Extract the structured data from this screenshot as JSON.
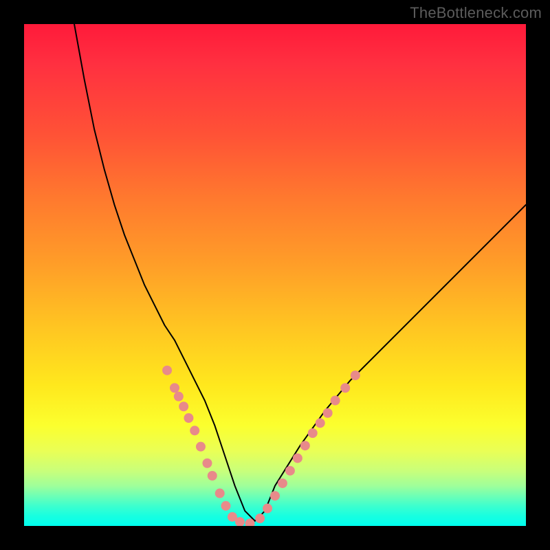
{
  "watermark": "TheBottleneck.com",
  "chart_data": {
    "type": "line",
    "title": "",
    "xlabel": "",
    "ylabel": "",
    "xlim": [
      0,
      100
    ],
    "ylim": [
      0,
      100
    ],
    "grid": false,
    "series": [
      {
        "name": "curve",
        "color": "#000000",
        "stroke_width": 2,
        "x": [
          10,
          12,
          14,
          16,
          18,
          20,
          22,
          24,
          26,
          28,
          30,
          32,
          34,
          36,
          38,
          40,
          42,
          44,
          46,
          48,
          50,
          55,
          60,
          65,
          70,
          75,
          80,
          85,
          90,
          95,
          100
        ],
        "y": [
          100,
          89,
          79,
          71,
          64,
          58,
          53,
          48,
          44,
          40,
          37,
          33,
          29,
          25,
          20,
          14,
          8,
          3,
          1,
          3,
          8,
          16,
          23,
          29,
          34,
          39,
          44,
          49,
          54,
          59,
          64
        ]
      }
    ],
    "markers": {
      "name": "dots",
      "color": "#e88a8a",
      "radius_px": 7,
      "points": [
        {
          "x": 28.5,
          "y": 31.0
        },
        {
          "x": 30.0,
          "y": 27.5
        },
        {
          "x": 30.8,
          "y": 25.8
        },
        {
          "x": 31.8,
          "y": 23.8
        },
        {
          "x": 32.8,
          "y": 21.5
        },
        {
          "x": 34.0,
          "y": 19.0
        },
        {
          "x": 35.2,
          "y": 15.8
        },
        {
          "x": 36.5,
          "y": 12.5
        },
        {
          "x": 37.5,
          "y": 10.0
        },
        {
          "x": 39.0,
          "y": 6.5
        },
        {
          "x": 40.2,
          "y": 4.0
        },
        {
          "x": 41.5,
          "y": 1.8
        },
        {
          "x": 43.0,
          "y": 0.8
        },
        {
          "x": 45.0,
          "y": 0.5
        },
        {
          "x": 47.0,
          "y": 1.5
        },
        {
          "x": 48.5,
          "y": 3.5
        },
        {
          "x": 50.0,
          "y": 6.0
        },
        {
          "x": 51.5,
          "y": 8.5
        },
        {
          "x": 53.0,
          "y": 11.0
        },
        {
          "x": 54.5,
          "y": 13.5
        },
        {
          "x": 56.0,
          "y": 16.0
        },
        {
          "x": 57.5,
          "y": 18.5
        },
        {
          "x": 59.0,
          "y": 20.5
        },
        {
          "x": 60.5,
          "y": 22.5
        },
        {
          "x": 62.0,
          "y": 25.0
        },
        {
          "x": 64.0,
          "y": 27.5
        },
        {
          "x": 66.0,
          "y": 30.0
        }
      ]
    },
    "gradient_stops": [
      {
        "pct": 0,
        "color": "#ff1a3a"
      },
      {
        "pct": 50,
        "color": "#ffb425"
      },
      {
        "pct": 80,
        "color": "#fbff2e"
      },
      {
        "pct": 100,
        "color": "#00ffee"
      }
    ],
    "plot_bg": "#000000"
  }
}
